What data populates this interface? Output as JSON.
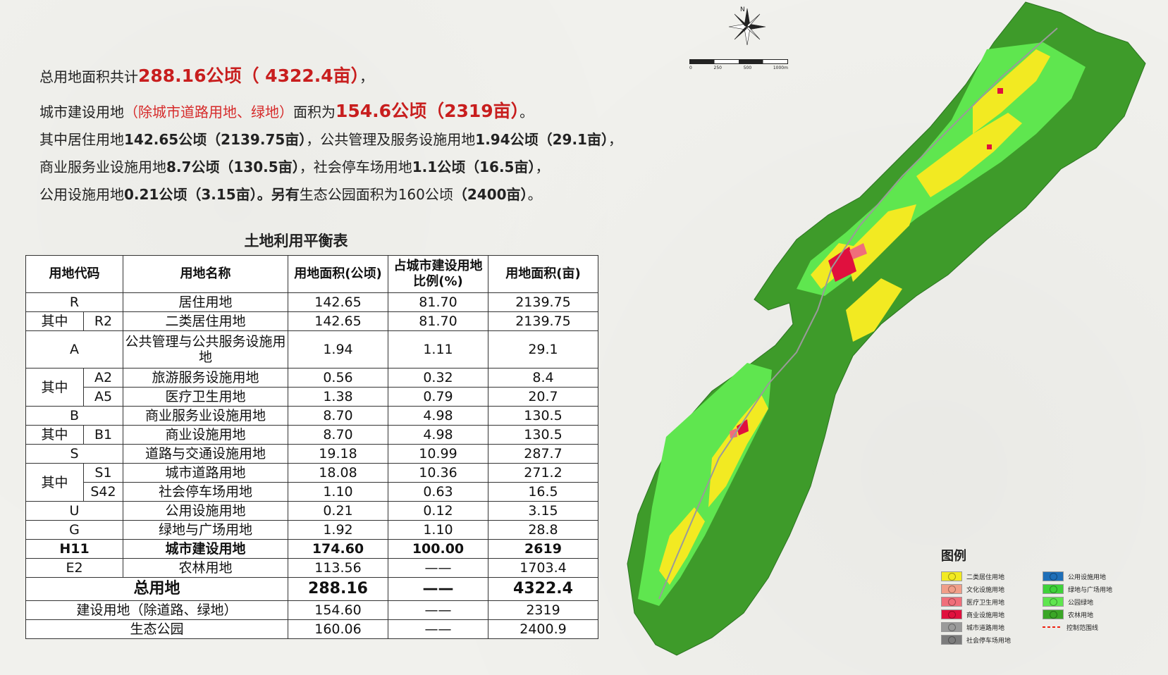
{
  "summary": {
    "l1_a": "总用地面积共计",
    "l1_b": "288.16公顷（ 4322.4亩）",
    "l1_c": "，",
    "l2_a": "城市建设用地",
    "l2_b": "（除城市道路用地、绿地）",
    "l2_c": "面积为",
    "l2_d": "154.6公顷（2319亩）",
    "l2_e": "。",
    "l3_a": "其中居住用地",
    "l3_b": "142.65公顷（2139.75亩）",
    "l3_c": "，公共管理及服务设施用地",
    "l3_d": "1.94公顷（29.1亩）",
    "l3_e": "，",
    "l4_a": "商业服务业设施用地",
    "l4_b": "8.7公顷（130.5亩）",
    "l4_c": "，社会停车场用地",
    "l4_d": "1.1公顷（16.5亩）",
    "l4_e": "，",
    "l5_a": "公用设施用地",
    "l5_b": "0.21公顷（3.15亩）。另有",
    "l5_c": "生态公园面积为160公顷",
    "l5_d": "（2400亩）",
    "l5_e": "。"
  },
  "table": {
    "title": "土地利用平衡表",
    "headers": {
      "code": "用地代码",
      "name": "用地名称",
      "area_ha": "用地面积(公顷)",
      "ratio_l1": "占城市建设用地",
      "ratio_l2": "比例(%)",
      "area_mu": "用地面积(亩)"
    },
    "qizhong": "其中",
    "dash": "——",
    "rows": {
      "R": {
        "code": "R",
        "name": "居住用地",
        "ha": "142.65",
        "pct": "81.70",
        "mu": "2139.75"
      },
      "R2": {
        "code": "R2",
        "name": "二类居住用地",
        "ha": "142.65",
        "pct": "81.70",
        "mu": "2139.75"
      },
      "A": {
        "code": "A",
        "name": "公共管理与公共服务设施用地",
        "ha": "1.94",
        "pct": "1.11",
        "mu": "29.1"
      },
      "A2": {
        "code": "A2",
        "name": "旅游服务设施用地",
        "ha": "0.56",
        "pct": "0.32",
        "mu": "8.4"
      },
      "A5": {
        "code": "A5",
        "name": "医疗卫生用地",
        "ha": "1.38",
        "pct": "0.79",
        "mu": "20.7"
      },
      "B": {
        "code": "B",
        "name": "商业服务业设施用地",
        "ha": "8.70",
        "pct": "4.98",
        "mu": "130.5"
      },
      "B1": {
        "code": "B1",
        "name": "商业设施用地",
        "ha": "8.70",
        "pct": "4.98",
        "mu": "130.5"
      },
      "S": {
        "code": "S",
        "name": "道路与交通设施用地",
        "ha": "19.18",
        "pct": "10.99",
        "mu": "287.7"
      },
      "S1": {
        "code": "S1",
        "name": "城市道路用地",
        "ha": "18.08",
        "pct": "10.36",
        "mu": "271.2"
      },
      "S42": {
        "code": "S42",
        "name": "社会停车场用地",
        "ha": "1.10",
        "pct": "0.63",
        "mu": "16.5"
      },
      "U": {
        "code": "U",
        "name": "公用设施用地",
        "ha": "0.21",
        "pct": "0.12",
        "mu": "3.15"
      },
      "G": {
        "code": "G",
        "name": "绿地与广场用地",
        "ha": "1.92",
        "pct": "1.10",
        "mu": "28.8"
      },
      "H11": {
        "code": "H11",
        "name": "城市建设用地",
        "ha": "174.60",
        "pct": "100.00",
        "mu": "2619"
      },
      "E2": {
        "code": "E2",
        "name": "农林用地",
        "ha": "113.56",
        "mu": "1703.4"
      },
      "total": {
        "name": "总用地",
        "ha": "288.16",
        "mu": "4322.4"
      },
      "build": {
        "name": "建设用地（除道路、绿地）",
        "ha": "154.60",
        "mu": "2319"
      },
      "eco": {
        "name": "生态公园",
        "ha": "160.06",
        "mu": "2400.9"
      }
    }
  },
  "map": {
    "north": "N",
    "scale": [
      "0",
      "250",
      "500",
      "1000m"
    ]
  },
  "legend": {
    "title": "图例",
    "items": [
      {
        "label": "二类居住用地",
        "color": "#f2ea22",
        "code": "R2"
      },
      {
        "label": "公用设施用地",
        "color": "#1f6fb8",
        "code": "U"
      },
      {
        "label": "文化设施用地",
        "color": "#f19e88",
        "code": "A2"
      },
      {
        "label": "绿地与广场用地",
        "color": "#3fd23a",
        "code": "G"
      },
      {
        "label": "医疗卫生用地",
        "color": "#f06e7a",
        "code": "A5"
      },
      {
        "label": "公园绿地",
        "color": "#5fe64f",
        "code": "G1"
      },
      {
        "label": "商业设施用地",
        "color": "#e0103e",
        "code": "B1"
      },
      {
        "label": "农林用地",
        "color": "#3aa626",
        "code": "E2"
      },
      {
        "label": "城市道路用地",
        "color": "#9a9a9a",
        "code": "S1"
      },
      {
        "label": "控制范围线",
        "color": "#e21",
        "code": "line"
      },
      {
        "label": "社会停车场用地",
        "color": "#7c7c7c",
        "code": "S42"
      }
    ]
  }
}
